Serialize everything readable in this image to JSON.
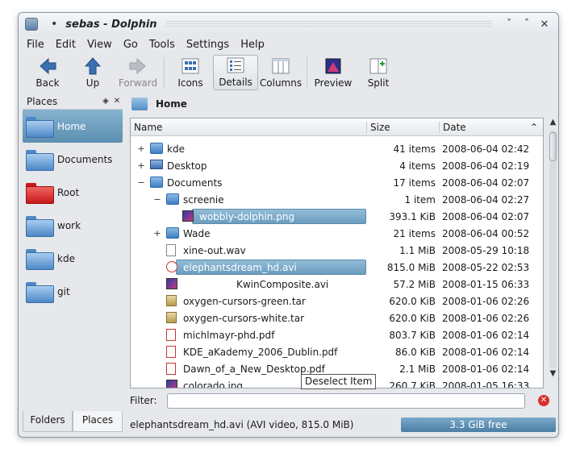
{
  "window": {
    "title": "sebas - Dolphin",
    "sticky_glyph": "•",
    "controls": [
      "ˇ",
      "ˆ",
      "✕"
    ]
  },
  "menu": [
    "File",
    "Edit",
    "View",
    "Go",
    "Tools",
    "Settings",
    "Help"
  ],
  "toolbar": {
    "back": "Back",
    "up": "Up",
    "forward": "Forward",
    "icons": "Icons",
    "details": "Details",
    "columns": "Columns",
    "preview": "Preview",
    "split": "Split"
  },
  "places": {
    "title": "Places",
    "items": [
      {
        "label": "Home",
        "color": [
          "#a9cdee",
          "#4d88c8",
          "#3a6ea8"
        ]
      },
      {
        "label": "Documents",
        "color": [
          "#a9cdee",
          "#4d88c8",
          "#3a6ea8"
        ]
      },
      {
        "label": "Root",
        "color": [
          "#f06464",
          "#c81818",
          "#9a1010"
        ]
      },
      {
        "label": "work",
        "color": [
          "#a9cdee",
          "#4d88c8",
          "#3a6ea8"
        ]
      },
      {
        "label": "kde",
        "color": [
          "#a9cdee",
          "#4d88c8",
          "#3a6ea8"
        ]
      },
      {
        "label": "git",
        "color": [
          "#a9cdee",
          "#4d88c8",
          "#3a6ea8"
        ]
      }
    ]
  },
  "tabs": {
    "folders": "Folders",
    "places": "Places"
  },
  "breadcrumb": "Home",
  "columns": {
    "name": "Name",
    "size": "Size",
    "date": "Date"
  },
  "rows": [
    {
      "expander": "+",
      "icon": "folder",
      "name": "kde",
      "size": "41 items",
      "date": "2008-06-04 02:42",
      "level": 0
    },
    {
      "expander": "+",
      "icon": "desk",
      "name": "Desktop",
      "size": "4 items",
      "date": "2008-06-04 02:19",
      "level": 0
    },
    {
      "expander": "−",
      "icon": "folder",
      "name": "Documents",
      "size": "17 items",
      "date": "2008-06-04 02:07",
      "level": 0
    },
    {
      "expander": "−",
      "icon": "folder",
      "name": "screenie",
      "size": "1 item",
      "date": "2008-06-04 02:27",
      "level": 1
    },
    {
      "expander": "",
      "icon": "img",
      "name": "wobbly-dolphin.png",
      "size": "393.1 KiB",
      "date": "2008-06-04 02:07",
      "level": 2,
      "highlight": true
    },
    {
      "expander": "+",
      "icon": "folder",
      "name": "Wade",
      "size": "21 items",
      "date": "2008-06-04 00:52",
      "level": 1
    },
    {
      "expander": "",
      "icon": "file",
      "name": "xine-out.wav",
      "size": "1.1 MiB",
      "date": "2008-05-29 10:18",
      "level": 1
    },
    {
      "expander": "",
      "icon": "avi",
      "name": "elephantsdream_hd.avi",
      "size": "815.0 MiB",
      "date": "2008-05-22 02:53",
      "level": 1,
      "highlight": true
    },
    {
      "expander": "",
      "icon": "img",
      "name": "KwinComposite.avi",
      "size": "57.2 MiB",
      "date": "2008-01-15 06:33",
      "level": 1,
      "partial": true
    },
    {
      "expander": "",
      "icon": "tar",
      "name": "oxygen-cursors-green.tar",
      "size": "620.0 KiB",
      "date": "2008-01-06 02:26",
      "level": 1
    },
    {
      "expander": "",
      "icon": "tar",
      "name": "oxygen-cursors-white.tar",
      "size": "620.0 KiB",
      "date": "2008-01-06 02:26",
      "level": 1
    },
    {
      "expander": "",
      "icon": "pdf",
      "name": "michlmayr-phd.pdf",
      "size": "803.7 KiB",
      "date": "2008-01-06 02:14",
      "level": 1
    },
    {
      "expander": "",
      "icon": "pdf",
      "name": "KDE_aKademy_2006_Dublin.pdf",
      "size": "86.0 KiB",
      "date": "2008-01-06 02:14",
      "level": 1
    },
    {
      "expander": "",
      "icon": "pdf",
      "name": "Dawn_of_a_New_Desktop.pdf",
      "size": "2.1 MiB",
      "date": "2008-01-06 02:14",
      "level": 1
    },
    {
      "expander": "",
      "icon": "img",
      "name": "colorado.jpg",
      "size": "260.7 KiB",
      "date": "2008-01-05 16:33",
      "level": 1
    }
  ],
  "tooltip": "Deselect Item",
  "filter": {
    "label": "Filter:",
    "value": ""
  },
  "status": {
    "text": "elephantsdream_hd.avi (AVI video, 815.0 MiB)",
    "free": "3.3 GiB free"
  }
}
